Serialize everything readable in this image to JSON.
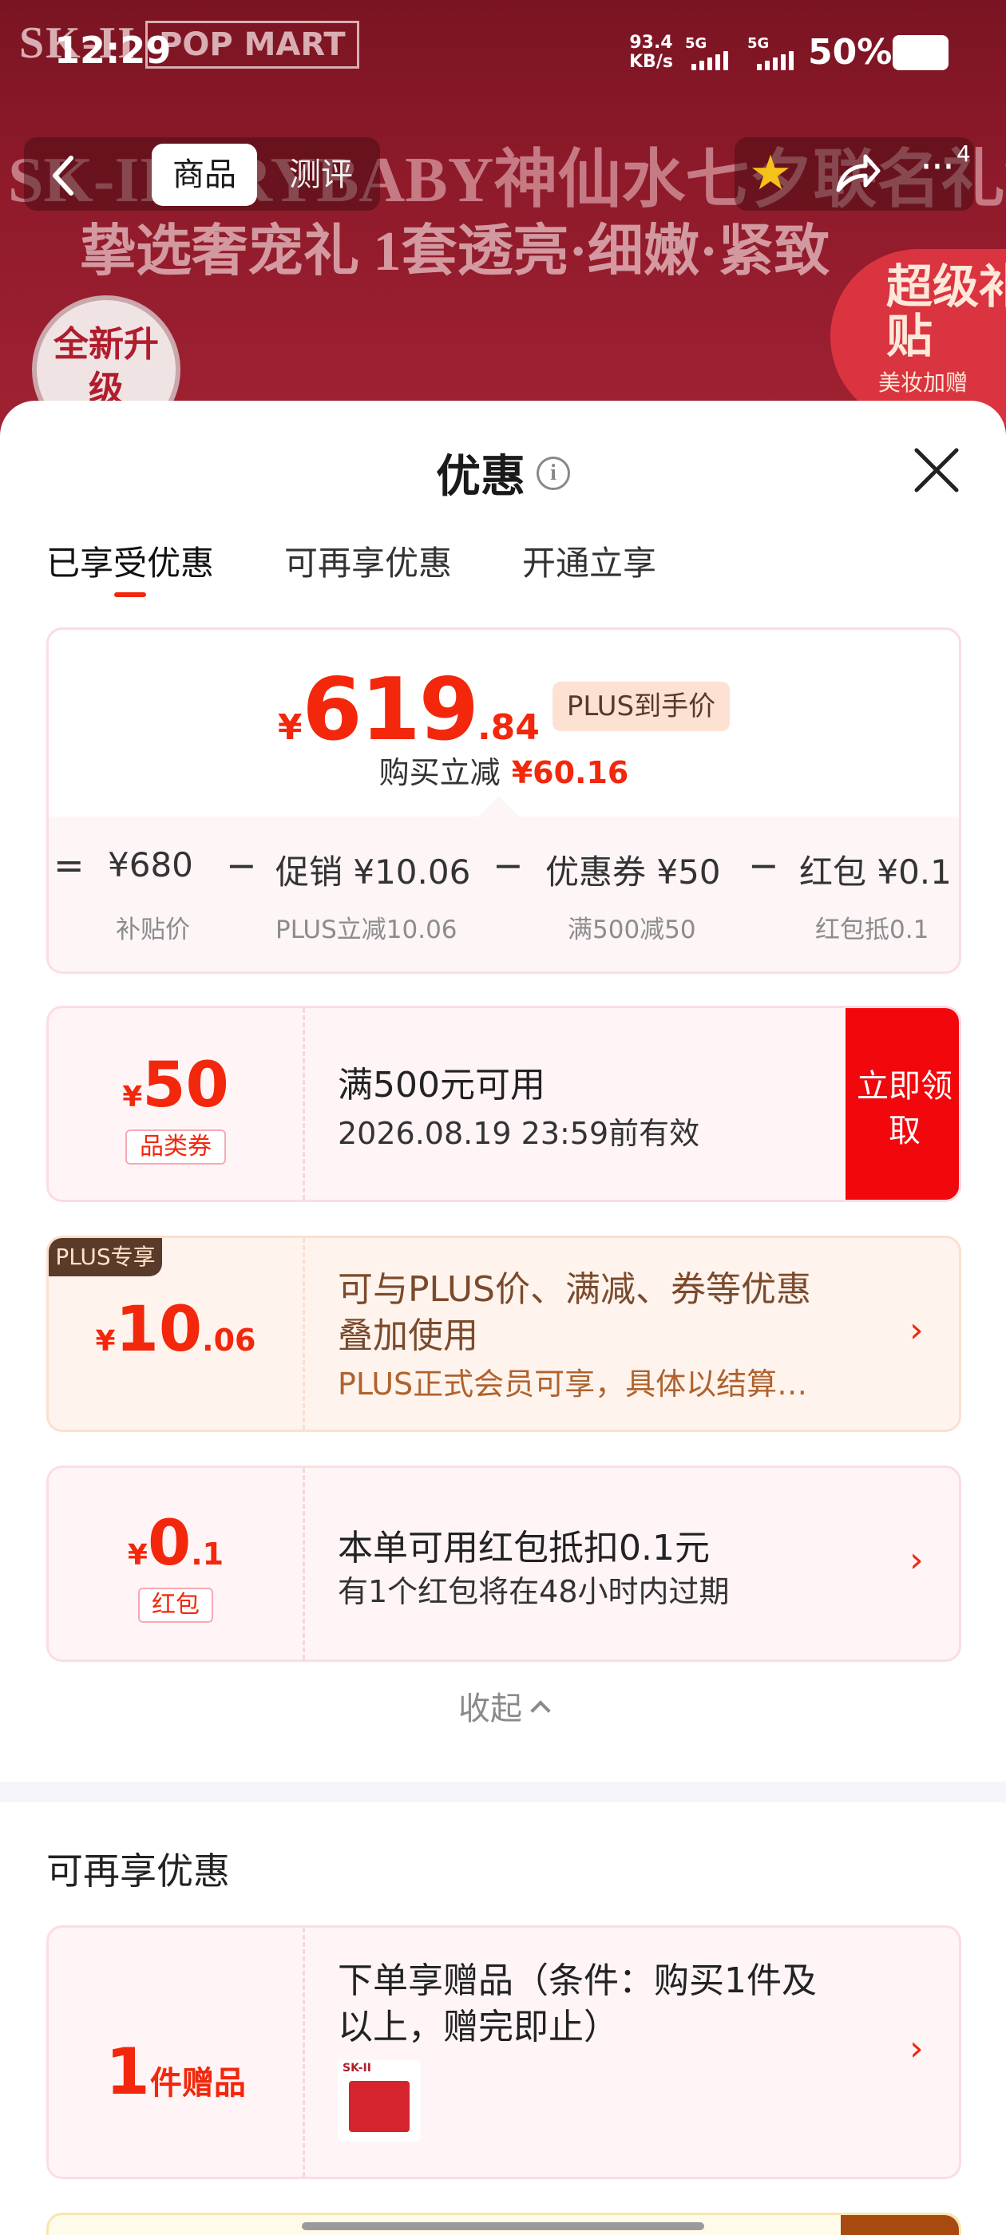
{
  "status_bar": {
    "time": "12:29",
    "net_speed_value": "93.4",
    "net_speed_unit": "KB/s",
    "sim1": "5G",
    "sim2": "5G",
    "battery": "50%"
  },
  "banner": {
    "logo": "SK-II",
    "logo_partner": "POP MART",
    "headline": "SK-II CRYBABY神仙水七夕联名礼盒",
    "subline": "挚选奢宠礼 1套透亮·细嫩·紧致",
    "seal_text": "全新升级",
    "badge_title": "超级补贴",
    "badge_sub": "美妆加赠"
  },
  "nav": {
    "tab_goods": "商品",
    "tab_review": "测评",
    "more_badge": "4"
  },
  "sheet": {
    "title": "优惠",
    "tabs": [
      "已享受优惠",
      "可再享优惠",
      "开通立享"
    ],
    "summary": {
      "price_yen": "¥",
      "price_int": "619",
      "price_dec": ".84",
      "price_tag": "PLUS到手价",
      "reduce_label": "购买立减",
      "reduce_value": "¥60.16",
      "eq": "=",
      "minus": "−",
      "terms": [
        {
          "main": "¥680",
          "sub": "补贴价"
        },
        {
          "main": "促销 ¥10.06",
          "sub": "PLUS立减10.06"
        },
        {
          "main": "优惠券 ¥50",
          "sub": "满500减50"
        },
        {
          "main": "红包 ¥0.1",
          "sub": "红包抵0.1"
        }
      ]
    },
    "coupons": [
      {
        "yen": "¥",
        "amount": "50",
        "tag": "品类券",
        "line1": "满500元可用",
        "line2": "2026.08.19 23:59前有效",
        "action": "立即领取"
      },
      {
        "badge": "PLUS专享",
        "yen": "¥",
        "amount_int": "10",
        "amount_dec": ".06",
        "line1": "可与PLUS价、满减、券等优惠",
        "line1b": "叠加使用",
        "line2": "PLUS正式会员可享，具体以结算…"
      },
      {
        "yen": "¥",
        "amount_int": "0",
        "amount_dec": ".1",
        "tag": "红包",
        "line1": "本单可用红包抵扣0.1元",
        "line2": "有1个红包将在48小时内过期"
      }
    ],
    "collapse_label": "收起",
    "more_section": {
      "title": "可再享优惠",
      "gift": {
        "qty": "1",
        "unit": "件赠品",
        "line1": "下单享赠品（条件：购买1件及",
        "line1b": "以上，赠完即止）",
        "thumb_logo": "SK-II"
      }
    }
  }
}
